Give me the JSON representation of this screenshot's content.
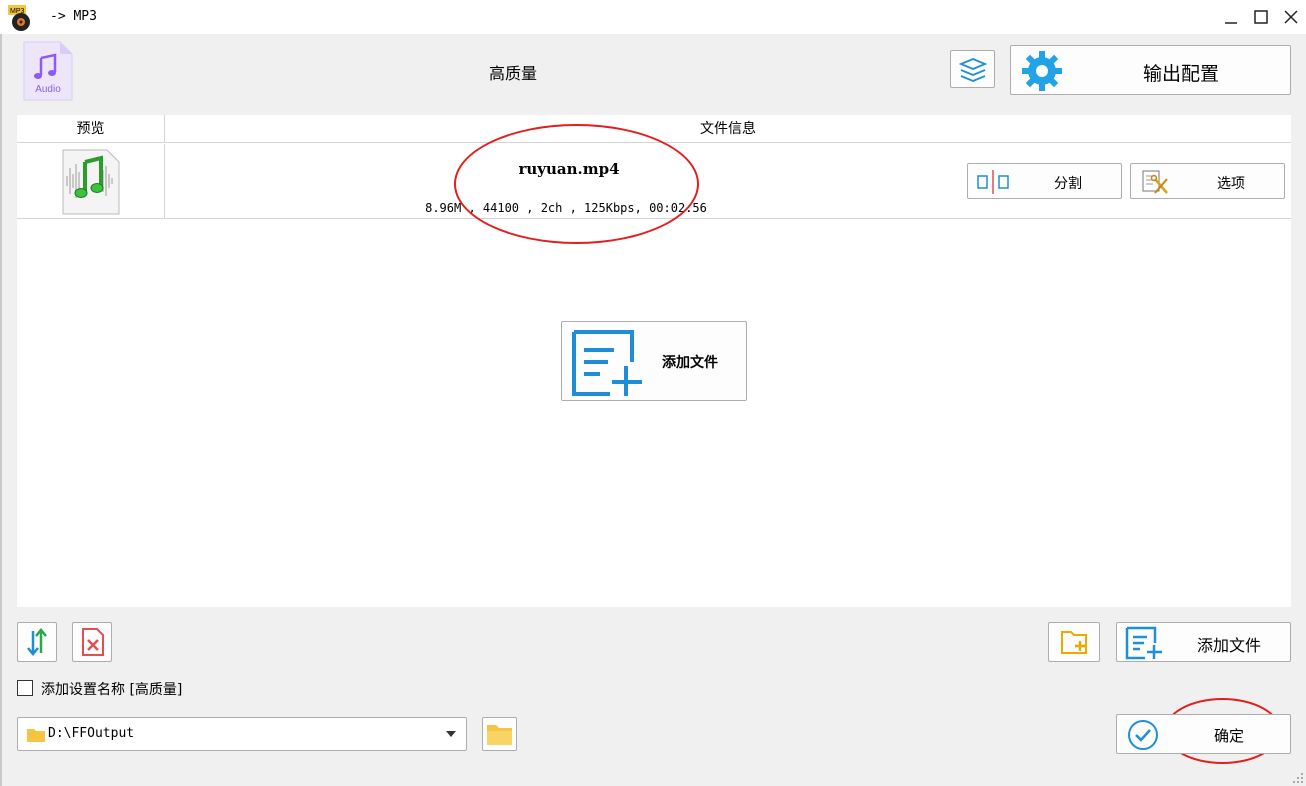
{
  "window": {
    "title": "-> MP3",
    "app_icon": "mp3-app-icon",
    "controls": [
      "minimize-icon",
      "maximize-icon",
      "close-icon"
    ]
  },
  "preset": {
    "icon": "audio-file-icon",
    "icon_label": "Audio",
    "name": "高质量"
  },
  "toolbar": {
    "layers_icon": "layers-icon",
    "output_config_label": "输出配置",
    "output_config_icon": "gear-icon"
  },
  "file_list": {
    "columns": [
      "预览",
      "文件信息"
    ],
    "items": [
      {
        "thumbnail_icon": "music-file-icon",
        "name": "ruyuan.mp4",
        "meta": "8.96M , 44100 , 2ch , 125Kbps, 00:02:56",
        "split_label": "分割",
        "options_label": "选项"
      }
    ],
    "center_add_label": "添加文件"
  },
  "bottom": {
    "add_file_label": "添加文件",
    "add_setting_name_label": "添加设置名称 [高质量]",
    "add_setting_name_checked": false,
    "output_path": "D:\\FFOutput",
    "ok_label": "确定"
  },
  "colors": {
    "accent_blue": "#1e8fd6",
    "folder_yellow": "#f4c542",
    "annotation_red": "#e02020",
    "audio_purple": "#8b5cf6"
  }
}
